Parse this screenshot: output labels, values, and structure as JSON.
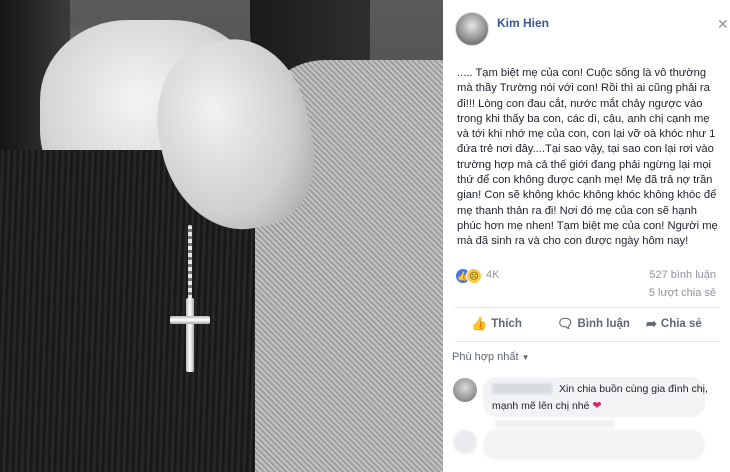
{
  "post": {
    "author": "Kim Hien",
    "text": "..... Tạm biệt mẹ của con! Cuộc sống là vô thường mà thầy Trường nói với con! Rồi thì ai cũng phải ra đi!!! Lòng con đau cắt, nước mắt chảy ngược vào trong khi thấy ba con, các dì, cậu, anh chị cạnh mẹ và tới khi nhớ mẹ của con, con lại vỡ oà khóc như 1 đứa trẻ nơi đây....Tại sao vậy, tại sao con lại rơi vào trường hợp mà cả thế giới đang phải ngừng lại mọi thứ để con không được cạnh mẹ! Mẹ đã trả nợ trần gian! Con sẽ không khóc không khóc không khóc để mẹ thanh thản ra đi! Nơi đó mẹ của con sẽ hạnh phúc hơn mẹ nhen! Tạm biệt mẹ của con! Người mẹ mà đã sinh ra và cho con được ngày hôm nay!"
  },
  "stats": {
    "reactions_count": "4K",
    "comments": "527 bình luận",
    "shares": "5 lượt chia sẻ"
  },
  "actions": {
    "like": "Thích",
    "comment": "Bình luận",
    "share": "Chia sẻ"
  },
  "comments_section": {
    "sort_label": "Phù hợp nhất"
  },
  "comment": {
    "line1": "Xin chia buồn cùng gia đình chị,",
    "line2": "mạnh mẽ lên chị nhé"
  },
  "icons": {
    "close": "close-icon",
    "like": "like-icon",
    "comment": "comment-icon",
    "share": "share-icon",
    "heart": "heart-icon"
  },
  "colors": {
    "author_link": "#385898",
    "like_reaction": "#4a76e8",
    "heart": "#e0245e"
  }
}
